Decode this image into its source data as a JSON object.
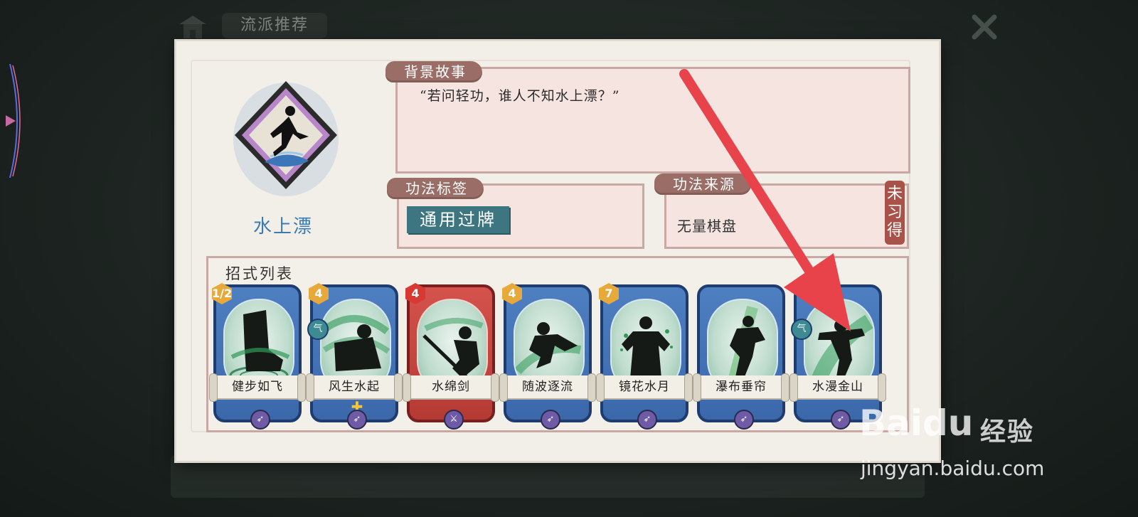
{
  "header": {
    "title": "流派推荐"
  },
  "skill": {
    "name": "水上漂"
  },
  "story": {
    "label": "背景故事",
    "text": "“若问轻功，谁人不知水上漂？”"
  },
  "tags": {
    "label": "功法标签",
    "value": "通用过牌"
  },
  "source": {
    "label": "功法来源",
    "value": "无量棋盘",
    "status": "未习得"
  },
  "moves": {
    "label": "招式列表",
    "cards": [
      {
        "name": "健步如飞",
        "cost": "1/2",
        "color": "blue",
        "qi": false,
        "plus": false
      },
      {
        "name": "风生水起",
        "cost": "4",
        "color": "blue",
        "qi": true,
        "plus": true
      },
      {
        "name": "水绵剑",
        "cost": "4",
        "color": "red",
        "qi": false,
        "plus": false
      },
      {
        "name": "随波逐流",
        "cost": "4",
        "color": "blue",
        "qi": false,
        "plus": false
      },
      {
        "name": "镜花水月",
        "cost": "7",
        "color": "blue",
        "qi": false,
        "plus": false
      },
      {
        "name": "瀑布垂帘",
        "cost": "",
        "color": "blue",
        "qi": false,
        "plus": false
      },
      {
        "name": "水漫金山",
        "cost": "",
        "color": "blue",
        "qi": true,
        "plus": false
      }
    ],
    "qi_label": "气"
  },
  "watermark": {
    "brand": "Baidu",
    "product": "经验",
    "url": "jingyan.baidu.com"
  },
  "colors": {
    "panel": "#f1efe8",
    "box": "#f6e4e1",
    "label": "#9a6e67",
    "arrow": "#e8424a",
    "card_blue": "#3b68aa",
    "card_red": "#b43a34"
  }
}
